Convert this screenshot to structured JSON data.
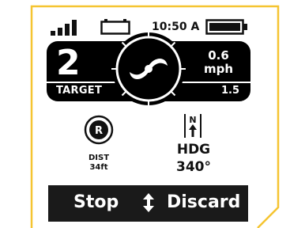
{
  "status_bar": {
    "time": "10:50 A",
    "signal_bars": 4,
    "battery_level": 1.0
  },
  "main_panel": {
    "target_number": "2",
    "speed_value": "0.6",
    "speed_unit": "mph",
    "target_label": "TARGET",
    "target_value": "1.5"
  },
  "distance": {
    "icon_letter": "R",
    "label": "DIST",
    "value": "34ft"
  },
  "heading": {
    "icon_letter": "N",
    "label": "HDG",
    "value": "340°"
  },
  "bottom_bar": {
    "left_label": "Stop",
    "right_label": "Discard"
  },
  "colors": {
    "accent": "#f5c431",
    "panel": "#000000",
    "text": "#111111"
  }
}
